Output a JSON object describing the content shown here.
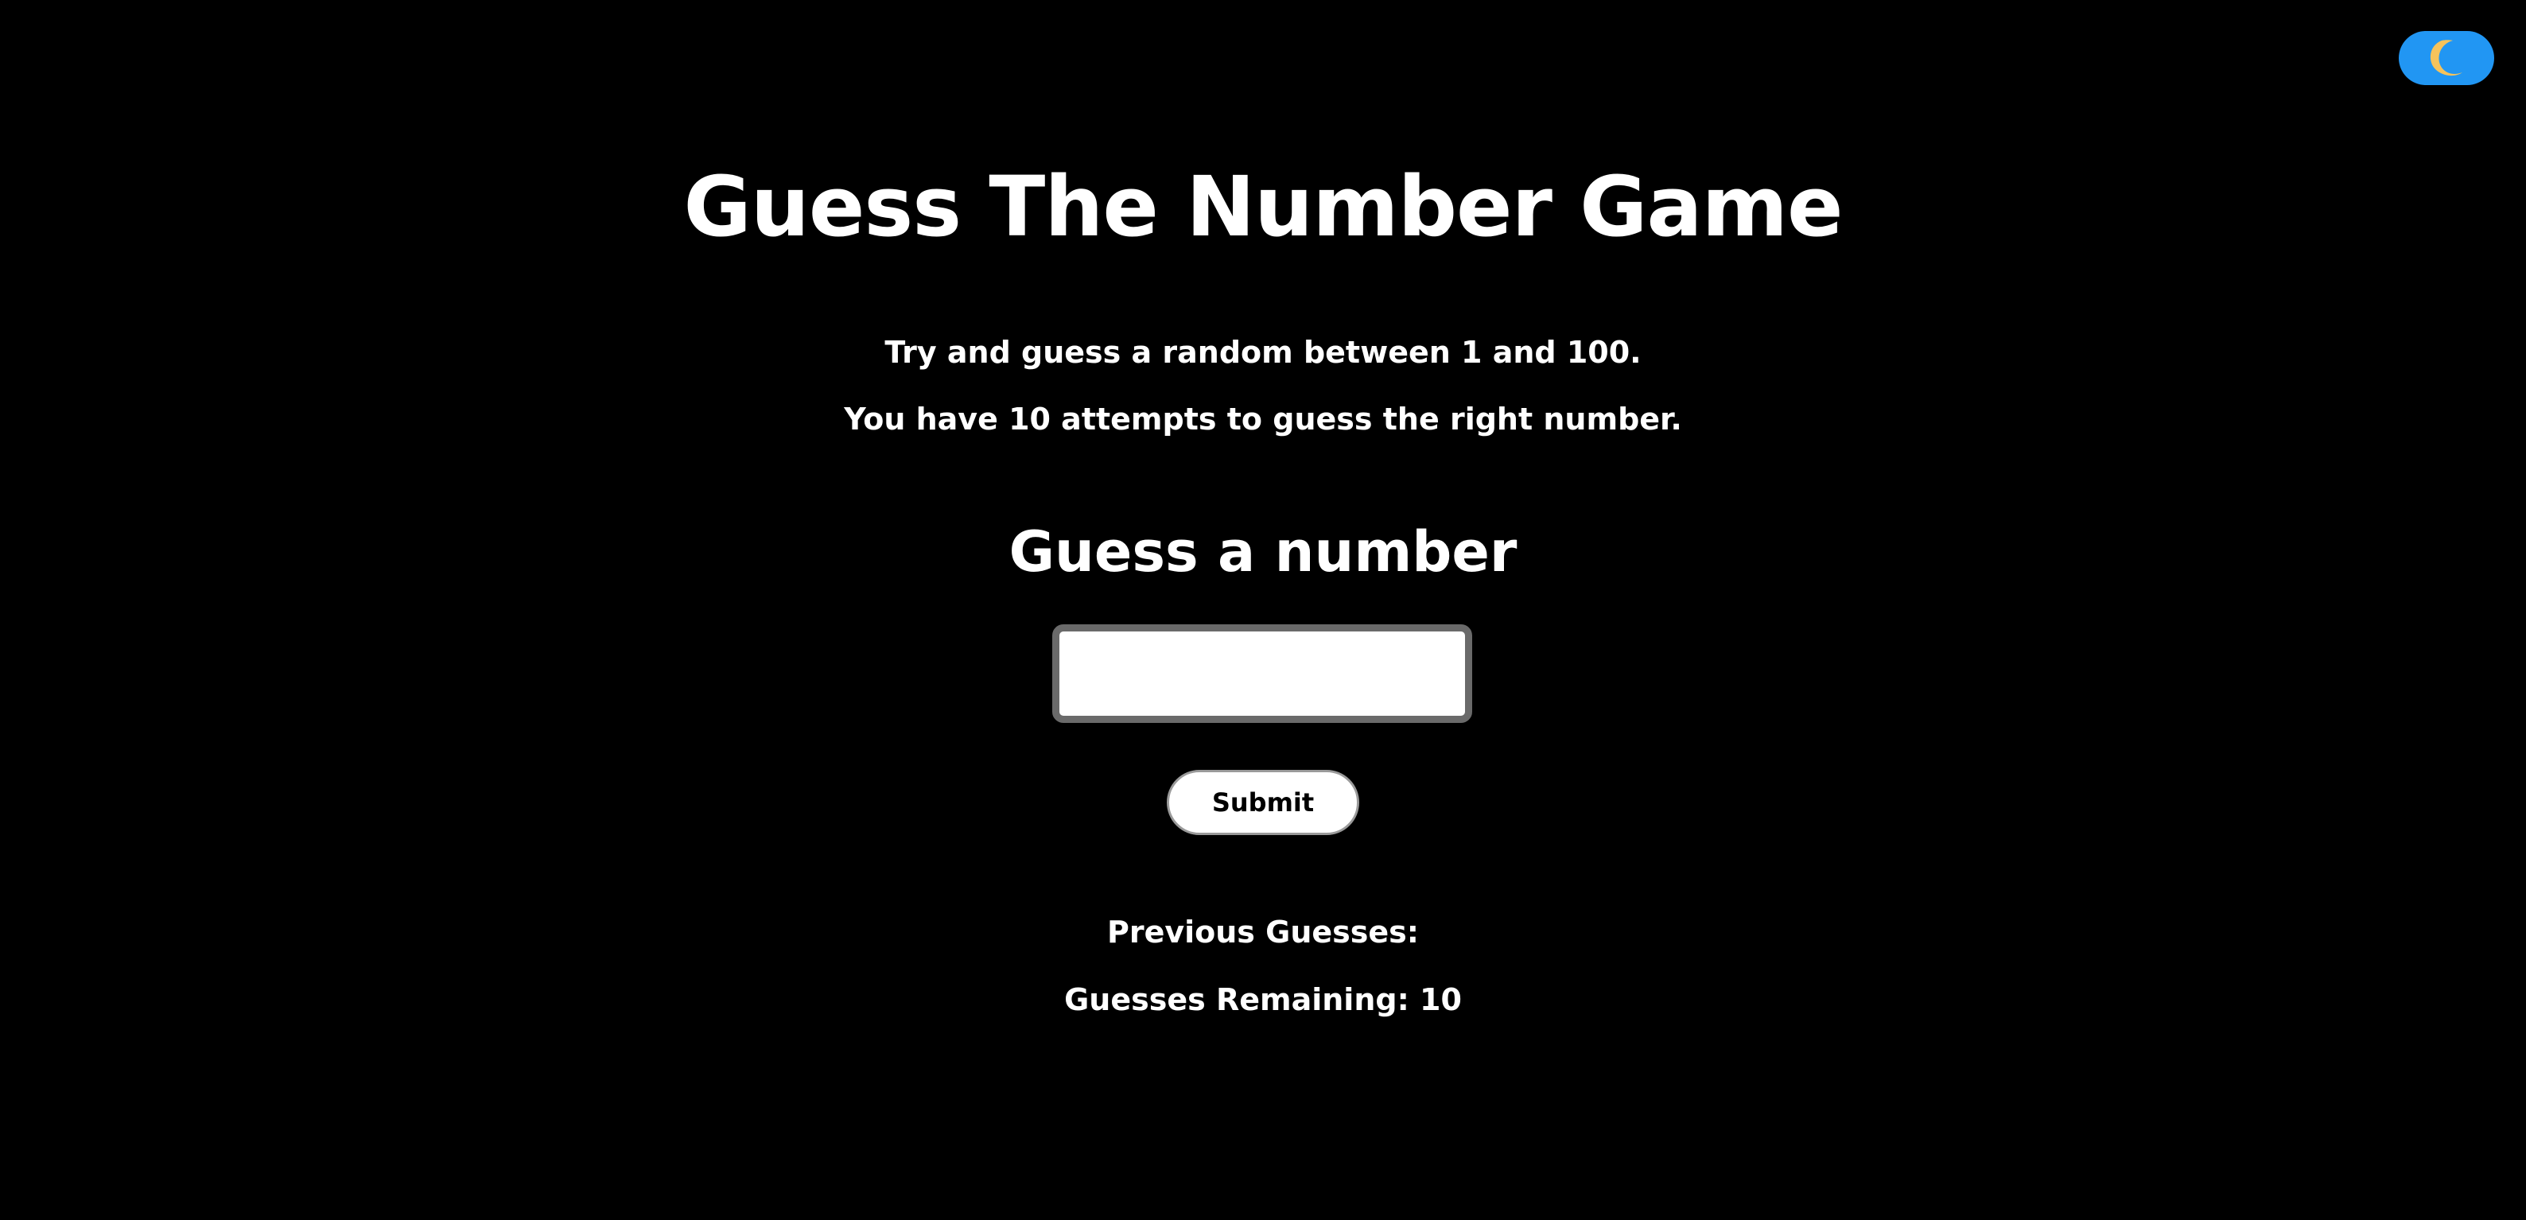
{
  "theme_toggle": {
    "icon": "crescent-moon-icon",
    "background_color": "#2196f3",
    "icon_color": "#f6c35b"
  },
  "game": {
    "title": "Guess The Number Game",
    "description_line1": "Try and guess a random between 1 and 100.",
    "description_line2": "You have 10 attempts to guess the right number.",
    "prompt": "Guess a number",
    "input_value": "",
    "submit_label": "Submit",
    "previous_guesses_label": "Previous Guesses:",
    "guesses_remaining_label": "Guesses Remaining:",
    "guesses_remaining_value": "10"
  },
  "colors": {
    "background": "#000000",
    "text": "#ffffff",
    "input_border": "#6a6a6a"
  }
}
